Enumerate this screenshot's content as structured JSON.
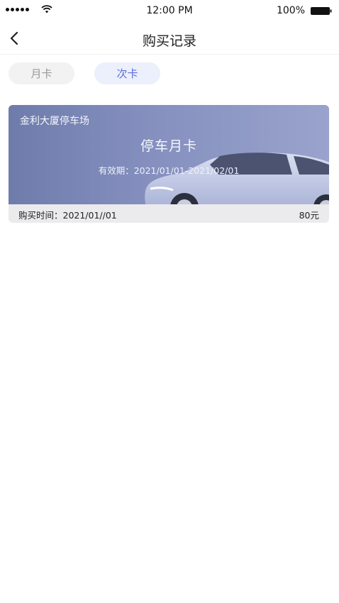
{
  "status_bar": {
    "time": "12:00 PM",
    "battery": "100%"
  },
  "nav": {
    "title": "购买记录"
  },
  "tabs": [
    {
      "label": "月卡",
      "active": false
    },
    {
      "label": "次卡",
      "active": true
    }
  ],
  "records": [
    {
      "lot_name": "金利大厦停车场",
      "card_type": "停车月卡",
      "validity": "有效期：2021/01/01-2021/02/01",
      "purchase_time": "购买时间：2021/01//01",
      "price": "80元"
    }
  ],
  "colors": {
    "accent": "#5a6fd8",
    "card_gradient_start": "#6f7cab",
    "card_gradient_end": "#9aa3cc"
  }
}
